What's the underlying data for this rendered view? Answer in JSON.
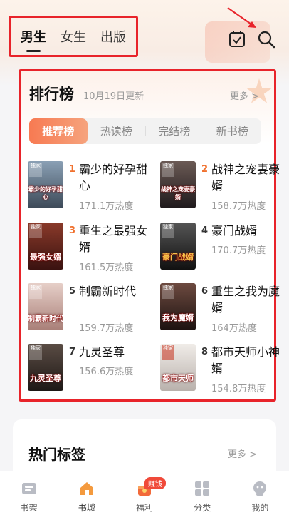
{
  "header": {
    "tabs": [
      {
        "label": "男生",
        "active": true
      },
      {
        "label": "女生",
        "active": false
      },
      {
        "label": "出版",
        "active": false
      }
    ]
  },
  "ranking": {
    "title": "排行榜",
    "updated": "10月19日更新",
    "more": "更多 >",
    "subtabs": [
      {
        "label": "推荐榜",
        "active": true
      },
      {
        "label": "热读榜",
        "active": false
      },
      {
        "label": "完结榜",
        "active": false
      },
      {
        "label": "新书榜",
        "active": false
      }
    ],
    "items": [
      {
        "rank": "1",
        "title": "霸少的好孕甜心",
        "heat": "171.1万热度",
        "badge": "独家",
        "cover_text": "霸少的好孕甜心",
        "cover_color": "#5a6b7d"
      },
      {
        "rank": "2",
        "title": "战神之宠妻豪婿",
        "heat": "158.7万热度",
        "badge": "独家",
        "cover_text": "战神之宠妻豪婿",
        "cover_color": "#3a2f35"
      },
      {
        "rank": "3",
        "title": "重生之最强女婿",
        "heat": "161.5万热度",
        "badge": "独家",
        "cover_text": "最强女婿",
        "cover_color": "#5c1f1a"
      },
      {
        "rank": "4",
        "title": "豪门战婿",
        "heat": "170.7万热度",
        "badge": "独家",
        "cover_text": "豪门战婿",
        "cover_color": "#2b2b2f"
      },
      {
        "rank": "5",
        "title": "制霸新时代",
        "heat": "159.7万热度",
        "badge": "独家",
        "cover_text": "制霸新时代",
        "cover_color": "#c9a8a0"
      },
      {
        "rank": "6",
        "title": "重生之我为魔婿",
        "heat": "164万热度",
        "badge": "独家",
        "cover_text": "我为魔婿",
        "cover_color": "#3a2a28"
      },
      {
        "rank": "7",
        "title": "九灵圣尊",
        "heat": "156.6万热度",
        "badge": "独家",
        "cover_text": "九灵圣尊",
        "cover_color": "#3d3530"
      },
      {
        "rank": "8",
        "title": "都市天师小神婿",
        "heat": "154.8万热度",
        "badge": "独家",
        "cover_text": "都市天师",
        "cover_color": "#d8d3cf"
      }
    ]
  },
  "tags": {
    "title": "热门标签",
    "more": "更多 >"
  },
  "bottom_nav": [
    {
      "label": "书架",
      "icon": "bookshelf-icon",
      "active": false
    },
    {
      "label": "书城",
      "icon": "bookstore-icon",
      "active": true
    },
    {
      "label": "福利",
      "icon": "gift-icon",
      "active": false,
      "badge": "赚钱"
    },
    {
      "label": "分类",
      "icon": "category-icon",
      "active": false
    },
    {
      "label": "我的",
      "icon": "profile-icon",
      "active": false
    }
  ],
  "colors": {
    "accent": "#f77a52",
    "rank_top3": "#f0712e",
    "rank_other": "#333333",
    "highlight_box": "#e8232a"
  }
}
